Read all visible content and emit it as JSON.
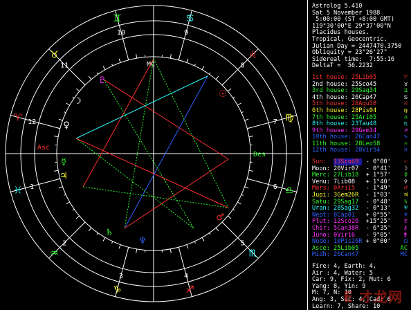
{
  "header": [
    "Astrolog 5.410",
    "Sat 5 November 1988",
    " 5:00:00 (ST +8:00 GMT)",
    "119°30'00\"E 29°37'00\"N",
    "Placidus houses.",
    "Tropical, Geocentric.",
    "Julian Day = 2447470.3750",
    "Obliquity = 23°26'27\"",
    "Sidereal time:  7:55:16",
    "DeltaT =  56.2232"
  ],
  "houses": [
    {
      "label": "1st house:",
      "value": "25Lib05",
      "color": "#ff3030",
      "glyph": "♈"
    },
    {
      "label": "2nd house:",
      "value": "25Sco45",
      "color": "#ffffff",
      "glyph": "♉"
    },
    {
      "label": "3rd house:",
      "value": "29Sag34",
      "color": "#30ff30",
      "glyph": "♊"
    },
    {
      "label": "4th house:",
      "value": "26Cap47",
      "color": "#ffffff",
      "glyph": "♋"
    },
    {
      "label": "5th house:",
      "value": "28Aqu58",
      "color": "#ff3030",
      "glyph": "♌"
    },
    {
      "label": "6th house:",
      "value": "28Pis04",
      "color": "#ffff30",
      "glyph": "♍"
    },
    {
      "label": "7th house:",
      "value": "25Ari05",
      "color": "#30ff30",
      "glyph": "♎"
    },
    {
      "label": "8th house:",
      "value": "23Tau48",
      "color": "#30ffff",
      "glyph": "♏"
    },
    {
      "label": "9th house:",
      "value": "29Gem34",
      "color": "#ff30ff",
      "glyph": "♐"
    },
    {
      "label": "10th house:",
      "value": "26Can47",
      "color": "#3060ff",
      "glyph": "♑"
    },
    {
      "label": "11th house:",
      "value": "28Leo58",
      "color": "#30ff30",
      "glyph": "♒"
    },
    {
      "label": "12th house:",
      "value": "28Vir54",
      "color": "#3060ff",
      "glyph": "♓"
    }
  ],
  "planets": [
    {
      "label": "Sun:",
      "value": "13Sco49",
      "aspect": " - 0°00'",
      "color": "#ff3030",
      "hl": true,
      "glyph": "☉"
    },
    {
      "label": "Moon:",
      "value": "20Vir07",
      "aspect": " - 0°41'",
      "color": "#ffffff",
      "hl": false,
      "glyph": "☽"
    },
    {
      "label": "Merc:",
      "value": "27Lib18",
      "aspect": " + 1°57'",
      "color": "#30ff30",
      "hl": false,
      "glyph": "☿"
    },
    {
      "label": "Venu:",
      "value": "7Lib08",
      "aspect": " + 1°40'",
      "color": "#ffffff",
      "hl": false,
      "glyph": "♀"
    },
    {
      "label": "Mars:",
      "value": "0Ari15",
      "aspect": " - 1°49'",
      "color": "#ff3030",
      "hl": false,
      "glyph": "♂"
    },
    {
      "label": "Jupi:",
      "value": "3Gem26R",
      "aspect": " - 1°03'",
      "color": "#ffff30",
      "hl": false,
      "glyph": "♃"
    },
    {
      "label": "Satu:",
      "value": "29Sag17",
      "aspect": " - 0°48'",
      "color": "#30ff30",
      "hl": false,
      "glyph": "♄"
    },
    {
      "label": "Uran:",
      "value": "28Sag32",
      "aspect": " - 0°13'",
      "color": "#30ffff",
      "hl": false,
      "glyph": "♅"
    },
    {
      "label": "Nept:",
      "value": "8Cap01",
      "aspect": " + 0°55'",
      "color": "#3060ff",
      "hl": false,
      "glyph": "♆"
    },
    {
      "label": "Plut:",
      "value": "12Sco26",
      "aspect": " +15°25'",
      "color": "#ff30ff",
      "hl": false,
      "glyph": "♇"
    },
    {
      "label": "Chir:",
      "value": "5Can38R",
      "aspect": " - 6°35'",
      "color": "#ff30ff",
      "hl": false,
      "glyph": "⚷"
    },
    {
      "label": "Juno:",
      "value": "0Vir16",
      "aspect": " - 9°05'",
      "color": "#ff30ff",
      "hl": false,
      "glyph": "⚵"
    },
    {
      "label": "Node:",
      "value": "10Pis26R",
      "aspect": " + 0°00'",
      "color": "#3060ff",
      "hl": false,
      "glyph": "☊"
    },
    {
      "label": "Asce:",
      "value": "25Lib05",
      "aspect": "",
      "color": "#30ff30",
      "hl": false,
      "glyph": "AC"
    },
    {
      "label": "Midh:",
      "value": "26Can47",
      "aspect": "",
      "color": "#3060ff",
      "hl": false,
      "glyph": "MC"
    }
  ],
  "elements": [
    "Fire: 4, Earth: 4,",
    "Air : 4, Water: 5",
    "Car: 9, Fix: 2, Mut: 6",
    "Yang: 8, Yin: 9",
    "M: 7, N: 10",
    "Ang: 3, Suc: 4, Cad: 6",
    "Learn: 7, Share: 10"
  ],
  "wheel": {
    "house_numbers": [
      "1",
      "2",
      "3",
      "4",
      "5",
      "6",
      "7",
      "8",
      "9",
      "10",
      "11",
      "12"
    ],
    "angle_labels": {
      "asc": "Asc",
      "des": "Des",
      "mc": "MC"
    },
    "sign_glyphs": [
      "♈",
      "♉",
      "♊",
      "♋",
      "♌",
      "♍",
      "♎",
      "♏",
      "♐",
      "♑",
      "♒",
      "♓"
    ]
  },
  "watermark": "E 才龙网"
}
